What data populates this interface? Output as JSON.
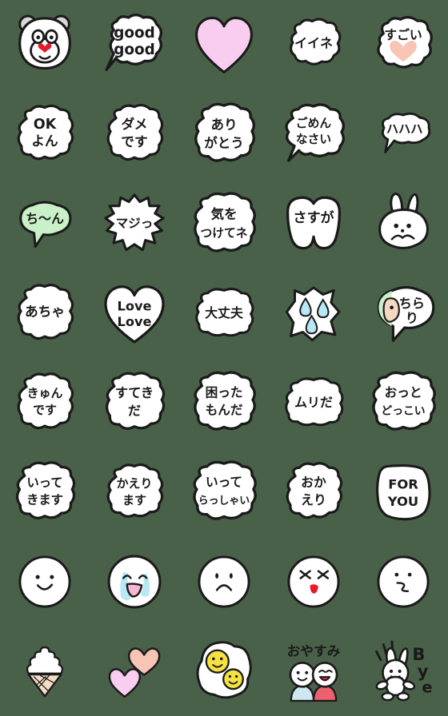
{
  "page": {
    "title": "Emoji sticker set preview grid",
    "background_color": "#4a6149",
    "columns": 5,
    "rows": 8,
    "sticker_count": 40
  },
  "palette": {
    "outline": "#1a1a1a",
    "bubble_fill": "#ffffff",
    "heart_pink": "#f9cdf0",
    "heart_peach": "#f8c4b4",
    "heart_red": "#e8192c",
    "bubble_green": "#caf0c8",
    "tear_blue": "#b7e8f5",
    "egg_yellow": "#f5e242",
    "shirt_blue": "#cfe7f2",
    "shirt_red": "#ec6070",
    "face_skin": "#f6d7c4",
    "cone_tan": "#f5ddc4",
    "ear_gray": "#d8d8d8"
  },
  "stickers": [
    {
      "id": 1,
      "row": 1,
      "col": 1,
      "name": "bear-face",
      "shape": "bear-head",
      "text": "",
      "label": "bear face with heart nose"
    },
    {
      "id": 2,
      "row": 1,
      "col": 2,
      "name": "good-good-bubble",
      "shape": "bubble-tail-left",
      "text": "good\ngood",
      "lines": [
        "good",
        "good"
      ],
      "label": "speech bubble reading good good"
    },
    {
      "id": 3,
      "row": 1,
      "col": 3,
      "name": "pink-heart",
      "shape": "heart",
      "text": "",
      "label": "large pink heart"
    },
    {
      "id": 4,
      "row": 1,
      "col": 4,
      "name": "iine-bubble",
      "shape": "cloud-bubble",
      "text": "イイネ",
      "lines": [
        "イイネ"
      ],
      "label": "bubble reading iine"
    },
    {
      "id": 5,
      "row": 1,
      "col": 5,
      "name": "sugoi-heart-bubble",
      "shape": "cloud-bubble-heart",
      "text": "すごい",
      "lines": [
        "すごい"
      ],
      "label": "bubble reading sugoi with peach heart"
    },
    {
      "id": 6,
      "row": 2,
      "col": 1,
      "name": "ok-yon-bubble",
      "shape": "cloud-bubble",
      "text": "OK\nよん",
      "lines": [
        "OK",
        "よん"
      ],
      "label": "bubble reading OK yon"
    },
    {
      "id": 7,
      "row": 2,
      "col": 2,
      "name": "dame-desu-bubble",
      "shape": "cloud-bubble",
      "text": "ダメ\nです",
      "lines": [
        "ダメ",
        "です"
      ],
      "label": "bubble reading dame desu"
    },
    {
      "id": 8,
      "row": 2,
      "col": 3,
      "name": "arigatou-bubble",
      "shape": "cloud-bubble",
      "text": "あり\nがとう",
      "lines": [
        "あり",
        "がとう"
      ],
      "label": "bubble reading arigatou"
    },
    {
      "id": 9,
      "row": 2,
      "col": 4,
      "name": "gomennasai-bubble",
      "shape": "bubble-tail-left",
      "text": "ごめん\nなさい",
      "lines": [
        "ごめん",
        "なさい"
      ],
      "label": "bubble reading gomennasai"
    },
    {
      "id": 10,
      "row": 2,
      "col": 5,
      "name": "hahaha-bubble",
      "shape": "bubble-tail-left",
      "text": "ハハハ",
      "lines": [
        "ハハハ"
      ],
      "label": "bubble reading hahaha"
    },
    {
      "id": 11,
      "row": 3,
      "col": 1,
      "name": "chiin-green-bubble",
      "shape": "bubble-green",
      "text": "ち〜ん",
      "lines": [
        "ち〜ん"
      ],
      "label": "green bubble reading chiin"
    },
    {
      "id": 12,
      "row": 3,
      "col": 2,
      "name": "maji-spiky-bubble",
      "shape": "spiky-bubble",
      "text": "マジっ",
      "lines": [
        "マジっ"
      ],
      "label": "spiky bubble reading maji"
    },
    {
      "id": 13,
      "row": 3,
      "col": 3,
      "name": "kiwotsukete-bubble",
      "shape": "cloud-bubble",
      "text": "気を\nつけてネ",
      "lines": [
        "気を",
        "つけてネ"
      ],
      "label": "bubble reading ki wo tsukete ne"
    },
    {
      "id": 14,
      "row": 3,
      "col": 4,
      "name": "sasuga-bubble",
      "shape": "double-lobe",
      "text": "さすが",
      "lines": [
        "さすが"
      ],
      "label": "bubble reading sasuga"
    },
    {
      "id": 15,
      "row": 3,
      "col": 5,
      "name": "rabbit-face",
      "shape": "rabbit-head",
      "text": "",
      "label": "rabbit face"
    },
    {
      "id": 16,
      "row": 4,
      "col": 1,
      "name": "acha-bubble",
      "shape": "cloud-bubble",
      "text": "あちゃ",
      "lines": [
        "あちゃ"
      ],
      "label": "bubble reading acha"
    },
    {
      "id": 17,
      "row": 4,
      "col": 2,
      "name": "love-love-heart",
      "shape": "heart-outline",
      "text": "Love\nLove",
      "lines": [
        "Love",
        "Love"
      ],
      "label": "white heart reading Love Love"
    },
    {
      "id": 18,
      "row": 4,
      "col": 3,
      "name": "daijoubu-bubble",
      "shape": "cloud-bubble",
      "text": "大丈夫",
      "lines": [
        "大丈夫"
      ],
      "label": "bubble reading daijoubu"
    },
    {
      "id": 19,
      "row": 4,
      "col": 4,
      "name": "sweat-drops",
      "shape": "spiky-drops",
      "text": "",
      "label": "panel with three sweat drops"
    },
    {
      "id": 20,
      "row": 4,
      "col": 5,
      "name": "chirari-bubble",
      "shape": "bubble-peek",
      "text": "ちらり",
      "lines": [
        "ちら",
        "り"
      ],
      "label": "bubble reading chirari with peeking face"
    },
    {
      "id": 21,
      "row": 5,
      "col": 1,
      "name": "kyun-desu-bubble",
      "shape": "cloud-bubble",
      "text": "きゅん\nです",
      "lines": [
        "きゅん",
        "です"
      ],
      "label": "bubble reading kyun desu"
    },
    {
      "id": 22,
      "row": 5,
      "col": 2,
      "name": "suteki-da-bubble",
      "shape": "cloud-bubble",
      "text": "すてき\nだ",
      "lines": [
        "すてき",
        "だ"
      ],
      "label": "bubble reading suteki da"
    },
    {
      "id": 23,
      "row": 5,
      "col": 3,
      "name": "komatta-monda-bubble",
      "shape": "cloud-bubble",
      "text": "困った\nもんだ",
      "lines": [
        "困った",
        "もんだ"
      ],
      "label": "bubble reading komatta monda"
    },
    {
      "id": 24,
      "row": 5,
      "col": 4,
      "name": "muri-da-bubble",
      "shape": "cloud-bubble",
      "text": "ムリだ",
      "lines": [
        "ムリだ"
      ],
      "label": "bubble reading muri da"
    },
    {
      "id": 25,
      "row": 5,
      "col": 5,
      "name": "otto-dokkoi-bubble",
      "shape": "cloud-bubble",
      "text": "おっと\nどっこい",
      "lines": [
        "おっと",
        "どっこい"
      ],
      "label": "bubble reading otto dokkoi"
    },
    {
      "id": 26,
      "row": 6,
      "col": 1,
      "name": "ittekimasu-bubble",
      "shape": "cloud-bubble",
      "text": "いって\nきます",
      "lines": [
        "いって",
        "きます"
      ],
      "label": "bubble reading ittekimasu"
    },
    {
      "id": 27,
      "row": 6,
      "col": 2,
      "name": "kaerimasu-bubble",
      "shape": "cloud-bubble",
      "text": "かえり\nます",
      "lines": [
        "かえり",
        "ます"
      ],
      "label": "bubble reading kaerimasu"
    },
    {
      "id": 28,
      "row": 6,
      "col": 3,
      "name": "itterasshai-bubble",
      "shape": "cloud-bubble",
      "text": "いって\nらっしゃい",
      "lines": [
        "いって",
        "らっしゃい"
      ],
      "label": "bubble reading itterasshai"
    },
    {
      "id": 29,
      "row": 6,
      "col": 4,
      "name": "okaeri-bubble",
      "shape": "cloud-bubble",
      "text": "おか\nえり",
      "lines": [
        "おか",
        "えり"
      ],
      "label": "bubble reading okaeri"
    },
    {
      "id": 30,
      "row": 6,
      "col": 5,
      "name": "for-you-bubble",
      "shape": "round-square",
      "text": "FOR\nYOU",
      "lines": [
        "FOR",
        "YOU"
      ],
      "label": "bubble reading FOR YOU"
    },
    {
      "id": 31,
      "row": 7,
      "col": 1,
      "name": "smiling-face",
      "shape": "face-smile",
      "text": "",
      "label": "smiling face"
    },
    {
      "id": 32,
      "row": 7,
      "col": 2,
      "name": "crying-face",
      "shape": "face-crying",
      "text": "",
      "label": "crying face with tears"
    },
    {
      "id": 33,
      "row": 7,
      "col": 3,
      "name": "sad-face",
      "shape": "face-sad",
      "text": "",
      "label": "sad face"
    },
    {
      "id": 34,
      "row": 7,
      "col": 4,
      "name": "dizzy-face",
      "shape": "face-dizzy",
      "text": "",
      "label": "face with x eyes and red tongue"
    },
    {
      "id": 35,
      "row": 7,
      "col": 5,
      "name": "smirk-face",
      "shape": "face-smirk",
      "text": "",
      "label": "face with squiggly mouth"
    },
    {
      "id": 36,
      "row": 8,
      "col": 1,
      "name": "ice-cream-cone",
      "shape": "ice-cream",
      "text": "",
      "label": "soft serve ice cream cone"
    },
    {
      "id": 37,
      "row": 8,
      "col": 2,
      "name": "two-hearts",
      "shape": "two-hearts",
      "text": "",
      "label": "pink and peach hearts"
    },
    {
      "id": 38,
      "row": 8,
      "col": 3,
      "name": "fried-eggs-smiley",
      "shape": "fried-eggs",
      "text": "",
      "label": "fried eggs with smiley yolks"
    },
    {
      "id": 39,
      "row": 8,
      "col": 4,
      "name": "oyasumi-couple",
      "shape": "oyasumi",
      "text": "おやすみ",
      "lines": [
        "おやすみ"
      ],
      "label": "two people under the word oyasumi"
    },
    {
      "id": 40,
      "row": 8,
      "col": 5,
      "name": "bye-rabbit",
      "shape": "bye-rabbit",
      "text": "Bye",
      "lines": [
        "B",
        "y",
        "e"
      ],
      "label": "jumping rabbit with the word Bye"
    }
  ]
}
